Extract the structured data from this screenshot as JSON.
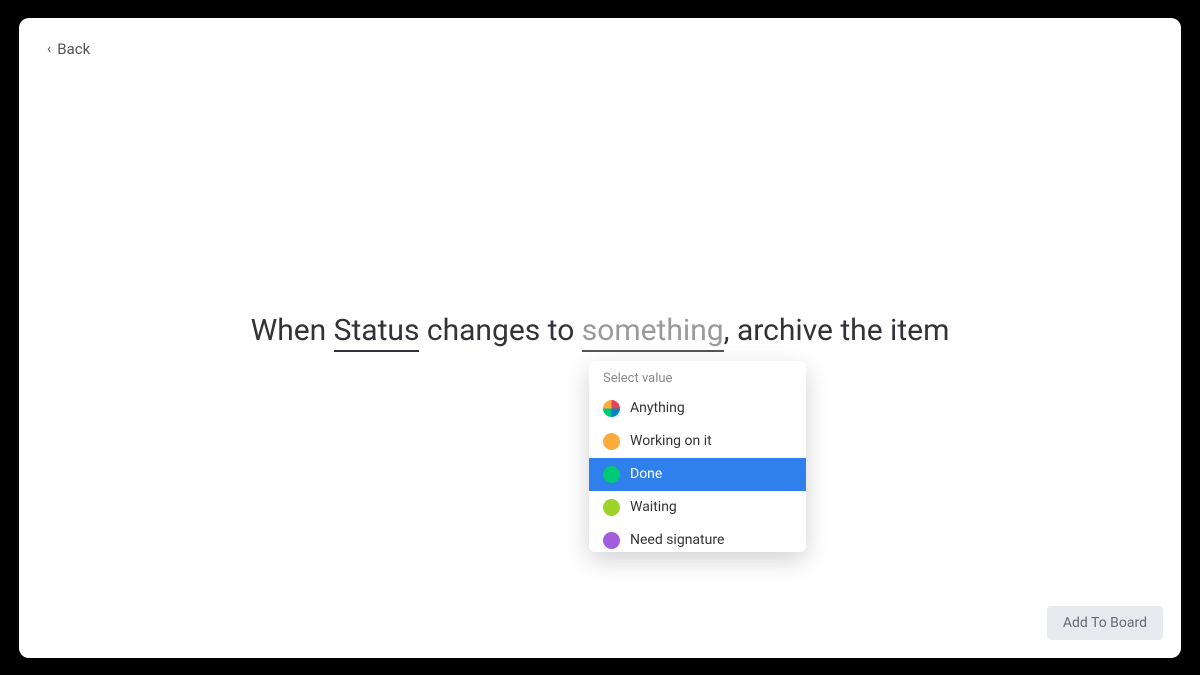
{
  "back": {
    "label": "Back"
  },
  "sentence": {
    "prefix": "When ",
    "status_token": "Status",
    "mid1": " changes to ",
    "something_token": "something",
    "suffix": ", archive the item"
  },
  "dropdown": {
    "header": "Select value",
    "options": [
      {
        "label": "Anything",
        "color": "multi"
      },
      {
        "label": "Working on it",
        "color": "#fdab3d"
      },
      {
        "label": "Done",
        "color": "#00c875",
        "selected": true
      },
      {
        "label": "Waiting",
        "color": "#9cd326"
      },
      {
        "label": "Need signature",
        "color": "#a25ddc"
      }
    ]
  },
  "footer": {
    "add_button": "Add To Board"
  }
}
